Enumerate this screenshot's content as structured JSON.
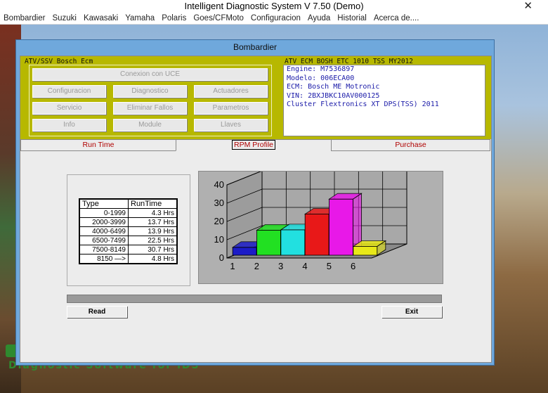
{
  "window": {
    "title": "Intelligent Diagnostic System V 7.50 (Demo)",
    "close_glyph": "✕"
  },
  "menu": [
    "Bombardier",
    "Suzuki",
    "Kawasaki",
    "Yamaha",
    "Polaris",
    "Goes/CFMoto",
    "Configuracion",
    "Ayuda",
    "Historial",
    "Acerca de...."
  ],
  "dialog": {
    "title": "Bombardier",
    "left_group_label": "ATV/SSV Bosch Ecm",
    "right_group_label": "ATV ECM BOSH ETC 1010 TSS MY2012",
    "buttons": {
      "connect": "Conexion con UCE",
      "config": "Configuracion",
      "diag": "Diagnostico",
      "actuators": "Actuadores",
      "service": "Servicio",
      "clear": "Eliminar Fallos",
      "params": "Parametros",
      "info": "Info",
      "module": "Module",
      "keys": "Llaves"
    },
    "info_lines": [
      "Engine: M7536897",
      "Modelo: 006ECA00",
      "ECM: Bosch ME Motronic",
      "VIN: 2BXJBKC10AV000125",
      "Cluster Flextronics XT DPS(TSS) 2011"
    ],
    "tabs": {
      "runtime": "Run Time",
      "rpm": "RPM Profile",
      "purchase": "Purchase"
    },
    "table": {
      "headers": [
        "Type",
        "RunTime"
      ],
      "rows": [
        [
          "0-1999",
          "4.3 Hrs"
        ],
        [
          "2000-3999",
          "13.7 Hrs"
        ],
        [
          "4000-6499",
          "13.9 Hrs"
        ],
        [
          "6500-7499",
          "22.5 Hrs"
        ],
        [
          "7500-8149",
          "30.7 Hrs"
        ],
        [
          "8150 —>",
          "4.8 Hrs"
        ]
      ]
    },
    "read_button": "Read",
    "exit_button": "Exit",
    "progress_fraction": 0
  },
  "brand": "Diagnostic Software for iDS",
  "chart_data": {
    "type": "bar",
    "categories": [
      "1",
      "2",
      "3",
      "4",
      "5",
      "6"
    ],
    "values": [
      4.3,
      13.7,
      13.9,
      22.5,
      30.7,
      4.8
    ],
    "ylim": [
      0,
      40
    ],
    "yticks": [
      "0",
      "10",
      "20",
      "30",
      "40"
    ],
    "colors": [
      "#1c1cc8",
      "#22e022",
      "#22e0e0",
      "#e81818",
      "#e818e8",
      "#e8e818"
    ],
    "grid": true
  }
}
